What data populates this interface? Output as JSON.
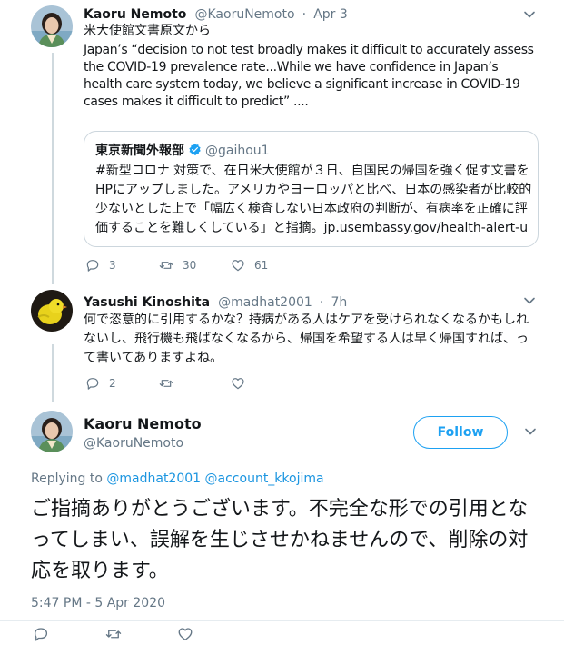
{
  "tweet1": {
    "name": "Kaoru Nemoto",
    "handle": "@KaoruNemoto",
    "sep": "·",
    "date": "Apr 3",
    "line1": "米大使館文書原文から",
    "text": "Japan’s “decision to not test broadly makes it difficult to accurately assess the COVID-19 prevalence rate...While we have confidence in Japan’s health care system today, we believe a significant increase in COVID-19 cases makes it difficult to predict” ....",
    "quote": {
      "name": "東京新聞外報部",
      "handle": "@gaihou1",
      "text": "#新型コロナ 対策で、在日米大使館が３日、自国民の帰国を強く促す文書をHPにアップしました。アメリカやヨーロッパと比べ、日本の感染者が比較的少ないとした上で「幅広く検査しない日本政府の判断が、有病率を正確に評価することを難しくしている」と指摘。jp.usembassy.gov/health-alert-u"
    },
    "replies": "3",
    "retweets": "30",
    "likes": "61"
  },
  "tweet2": {
    "name": "Yasushi Kinoshita",
    "handle": "@madhat2001",
    "sep": "·",
    "date": "7h",
    "text": "何で恣意的に引用するかな？持病がある人はケアを受けられなくなるかもしれないし、飛行機も飛ばなくなるから、帰国を希望する人は早く帰国すれば、って書いてありますよね。",
    "replies": "2"
  },
  "main": {
    "name": "Kaoru Nemoto",
    "handle": "@KaoruNemoto",
    "follow_label": "Follow",
    "replying_to": "Replying to",
    "mention1": "@madhat2001",
    "mention2": "@account_kkojima",
    "text": "ご指摘ありがとうございます。不完全な形での引用となってしまい、誤解を生じさせかねませんので、削除の対応を取ります。",
    "timestamp": "5:47 PM - 5 Apr 2020"
  },
  "colors": {
    "accent": "#1da1f2",
    "link": "#1b95e0",
    "muted": "#657786",
    "thread_line": "#cfd9de"
  },
  "icons": [
    "chevron-down-icon",
    "reply-icon",
    "retweet-icon",
    "like-icon",
    "verified-icon"
  ]
}
